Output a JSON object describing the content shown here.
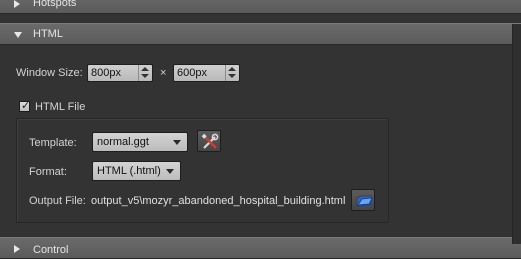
{
  "sections": {
    "hotspots": {
      "title": "Hotspots",
      "expanded": false
    },
    "html": {
      "title": "HTML",
      "expanded": true
    },
    "control": {
      "title": "Control",
      "expanded": false
    }
  },
  "window_size": {
    "label": "Window Size:",
    "width_value": "800px",
    "separator": "×",
    "height_value": "600px"
  },
  "html_file": {
    "label": "HTML File",
    "checked": true,
    "template": {
      "label": "Template:",
      "value": "normal.ggt",
      "edit_icon": "tools-icon"
    },
    "format": {
      "label": "Format:",
      "value": "HTML (.html)"
    },
    "output_file": {
      "label": "Output File:",
      "value": "output_v5\\mozyr_abandoned_hospital_building.html",
      "browse_icon": "folder-icon"
    }
  },
  "colors": {
    "background": "#333333",
    "header": "#606060",
    "field": "#c8c8c8"
  }
}
